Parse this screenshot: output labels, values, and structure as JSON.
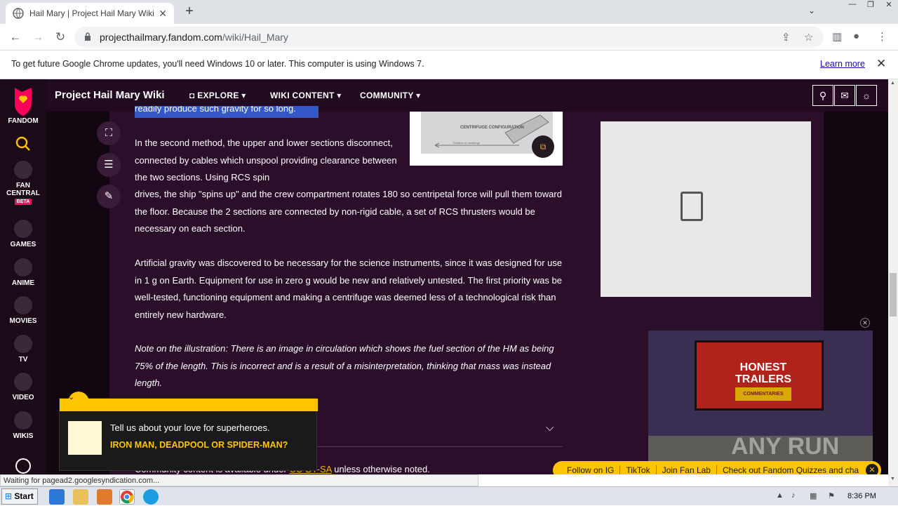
{
  "browser": {
    "tab_title": "Hail Mary | Project Hail Mary Wiki | F",
    "url_domain": "projecthailmary.fandom.com",
    "url_path": "/wiki/Hail_Mary",
    "window_min": "—",
    "window_max": "❐",
    "window_close": "✕"
  },
  "infobar": {
    "message": "To get future Google Chrome updates, you'll need Windows 10 or later. This computer is using Windows 7.",
    "learn_more": "Learn more"
  },
  "rail": {
    "fandom": "FANDOM",
    "fan_central": "FAN CENTRAL",
    "beta": "BETA",
    "games": "GAMES",
    "anime": "ANIME",
    "movies": "MOVIES",
    "tv": "TV",
    "video": "VIDEO",
    "wikis": "WIKIS"
  },
  "header": {
    "wiki_name": "Project Hail Mary Wiki",
    "explore": "EXPLORE",
    "wiki_content": "WIKI CONTENT",
    "community": "COMMUNITY"
  },
  "figure": {
    "label": "CENTRIFUGE CONFIGURATION",
    "caption": "Rotation of centrifuge"
  },
  "article": {
    "cut_line": "readily produce such gravity for so long.",
    "p1": "In the second method, the upper and lower sections disconnect, connected by cables which unspool providing clearance between the two sections. Using RCS spin",
    "p1b": "drives, the ship \"spins up\" and the crew compartment rotates 180 so centripetal force will pull them toward the floor. Because the 2 sections are connected by non-rigid cable, a set of RCS thrusters would be necessary on each section.",
    "p2": "Artificial gravity was discovered to be necessary for the science instruments, since it was designed for use in 1 g on Earth. Equipment for use in zero g would be new and relatively untested. The first priority was be well-tested, functioning equipment and making a centrifuge was deemed less of a technological risk than entirely new hardware.",
    "p3": "Note on the illustration: There is an image in circulation which shows the fuel section of the HM as being 75% of the length. This is incorrect and is a result of a misinterpretation, thinking that mass was instead length.",
    "license_pre": "Community content is available under ",
    "license_link": "CC-BY-SA",
    "license_post": " unless otherwise noted."
  },
  "video": {
    "honest": "HONEST",
    "trailers": "TRAILERS",
    "commentaries": "COMMENTARIES",
    "watermark": "ANY RUN"
  },
  "quiz": {
    "question": "Tell us about your love for superheroes.",
    "answer": "IRON MAN, DEADPOOL OR SPIDER-MAN?"
  },
  "bottom_bar": {
    "follow_ig": "Follow on IG",
    "tiktok": "TikTok",
    "fan_lab": "Join Fan Lab",
    "quizzes": "Check out Fandom Quizzes and cha"
  },
  "status_text": "Waiting for pagead2.googlesyndication.com...",
  "taskbar": {
    "start": "Start",
    "time": "8:36 PM"
  }
}
